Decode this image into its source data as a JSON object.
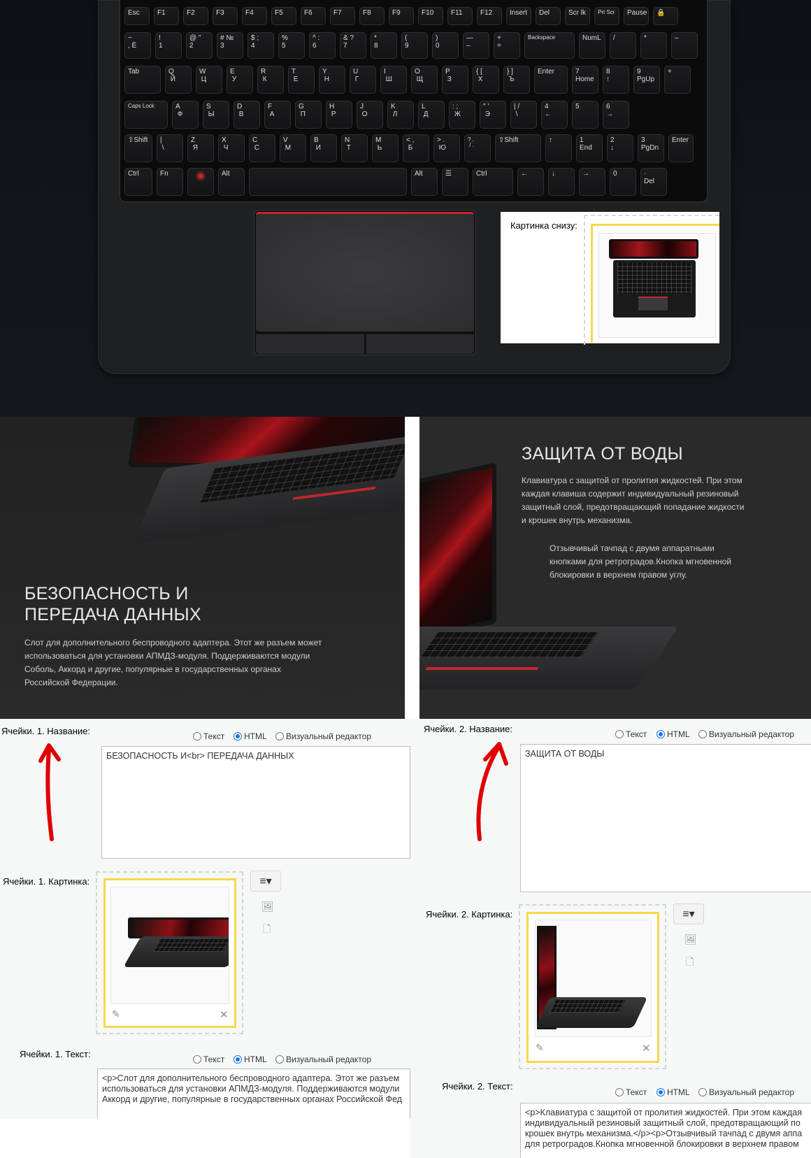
{
  "keyboard": {
    "rows": [
      [
        "Esc",
        "F1",
        "F2",
        "F3",
        "F4",
        "F5",
        "F6",
        "F7",
        "F8",
        "F9",
        "F10",
        "F11",
        "F12",
        "Insert",
        "Del",
        "Scr lk",
        "Prt Scr",
        "Pause",
        "🔒"
      ],
      [
        "~\n, Ё",
        "!\n1",
        "@ \"\n2",
        "# №\n3",
        "$ ;\n4",
        "%\n5",
        "^ :\n6",
        "& ?\n7",
        "*\n8",
        "(\n9",
        ")\n0",
        "—\n–",
        "+\n=",
        "Backspace",
        "NumL",
        "/",
        "*",
        "–"
      ],
      [
        "Tab",
        "Q\n Й",
        "W\n Ц",
        "E\n У",
        "R\n К",
        "T\n Е",
        "Y\n Н",
        "U\n Г",
        "I\n Ш",
        "O\n Щ",
        "P\n З",
        "{ [\n Х",
        "} ]\n Ъ",
        "Enter",
        "7\nHome",
        "8\n↑",
        "9\nPgUp",
        "+"
      ],
      [
        "Caps Lock",
        "A\n Ф",
        "S\n Ы",
        "D\n В",
        "F\n А",
        "G\n П",
        "H\n Р",
        "J\n О",
        "K\n Л",
        "L\n Д",
        ": ;\n Ж",
        "\" '\n Э",
        "| /\n \\",
        "4\n←",
        "5",
        "6\n→"
      ],
      [
        "⇧Shift",
        "|\n \\",
        "Z\n Я",
        "X\n Ч",
        "C\n С",
        "V\n М",
        "B\n И",
        "N\n Т",
        "M\n Ь",
        "< ,\n Б",
        "> .\n Ю",
        "? ,\n / .",
        "⇧Shift",
        "↑",
        "1\nEnd",
        "2\n↓",
        "3\nPgDn",
        "Enter"
      ],
      [
        "Ctrl",
        "Fn",
        "◉",
        "Alt",
        "",
        "Alt",
        "☰",
        "Ctrl",
        "←",
        "↓",
        "→",
        "0",
        "·\nDel"
      ]
    ]
  },
  "overlay": {
    "label": "Картинка снизу:"
  },
  "banner_left": {
    "title_line1": "БЕЗОПАСНОСТЬ И",
    "title_line2": "ПЕРЕДАЧА ДАННЫХ",
    "text": "Слот для дополнительного беспроводного адаптера. Этот же разъем может\nиспользоваться для установки АПМДЗ-модуля. Поддерживаются модули\nСоболь, Аккорд и другие, популярные в государственных органах\nРоссийской Федерации."
  },
  "banner_right": {
    "title": "ЗАЩИТА ОТ ВОДЫ",
    "text1": "Клавиатура с защитой от пролития жидкостей. При этом\nкаждая клавиша содержит индивидуальный резиновый\nзащитный слой, предотвращающий попадание жидкости\nи крошек внутрь механизма.",
    "text2": "Отзывчивый тачпад с двумя аппаратными\nкнопками для ретроградов.Кнопка мгновенной\nблокировки в верхнем правом углу."
  },
  "form": {
    "radio_labels": [
      "Текст",
      "HTML",
      "Визуальный редактор"
    ],
    "cell1": {
      "name_label": "Ячейки. 1. Название:",
      "name_value": "БЕЗОПАСНОСТЬ И<br> ПЕРЕДАЧА ДАННЫХ",
      "picture_label": "Ячейки. 1. Картинка:",
      "text_label": "Ячейки. 1. Текст:",
      "text_value": "<p>Слот для дополнительного беспроводного адаптера. Этот же разъем\nиспользоваться для установки АПМДЗ-модуля. Поддерживаются модули\nАккорд и другие, популярные в государственных органах Российской Фед"
    },
    "cell2": {
      "name_label": "Ячейки. 2. Название:",
      "name_value": "ЗАЩИТА ОТ ВОДЫ",
      "picture_label": "Ячейки. 2. Картинка:",
      "text_label": "Ячейки. 2. Текст:",
      "text_value": "<p>Клавиатура с защитой от пролития жидкостей. При этом каждая\nиндивидуальный резиновый защитный слой, предотвращающий по\nкрошек внутрь механизма.</p><p>Отзывчивый тачпад с двумя аппа\nдля ретроградов.Кнопка мгновенной блокировки в верхнем правом"
    },
    "selected_mode": "HTML"
  },
  "colors": {
    "accent_red": "#c2272d",
    "arrow_red": "#e00000",
    "highlight_yellow": "#f6d84a",
    "radio_blue": "#1a73e8"
  }
}
